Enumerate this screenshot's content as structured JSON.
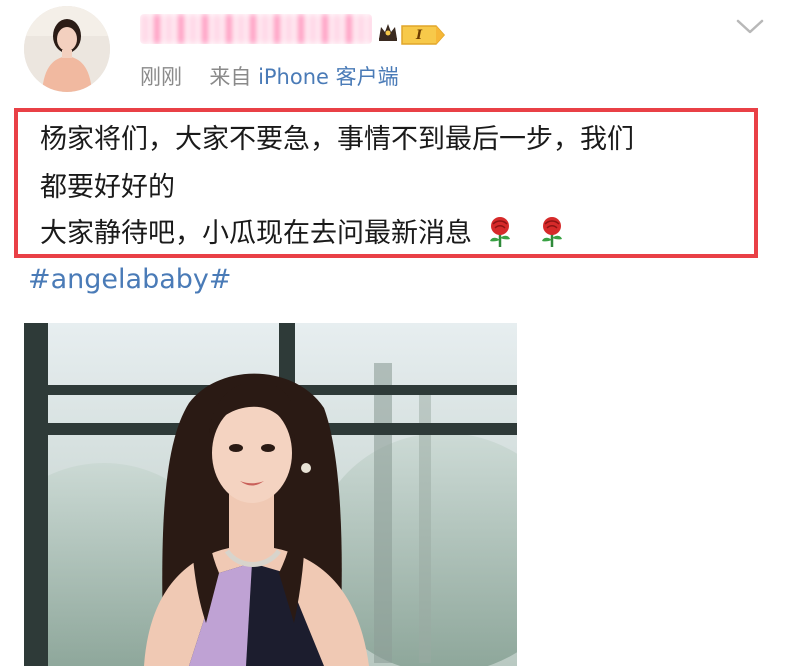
{
  "post": {
    "author": {
      "avatar": "avatar-photo",
      "crown_icon": "crown-icon",
      "level": "I"
    },
    "meta": {
      "time": "刚刚",
      "source_prefix": "来自",
      "source_app": "iPhone 客户端"
    },
    "content": {
      "line1": "杨家将们，大家不要急，事情不到最后一步，我们",
      "line2": "都要好好的",
      "line3": "大家静待吧，小瓜现在去问最新消息",
      "emoji": [
        "rose-emoji",
        "rose-emoji"
      ]
    },
    "hashtag": "#angelababy#",
    "image": "post-photo"
  },
  "colors": {
    "link": "#4a7bb7",
    "meta_text": "#8a8a8a",
    "highlight_border": "#e94046",
    "level_badge": "#f7c94a"
  }
}
